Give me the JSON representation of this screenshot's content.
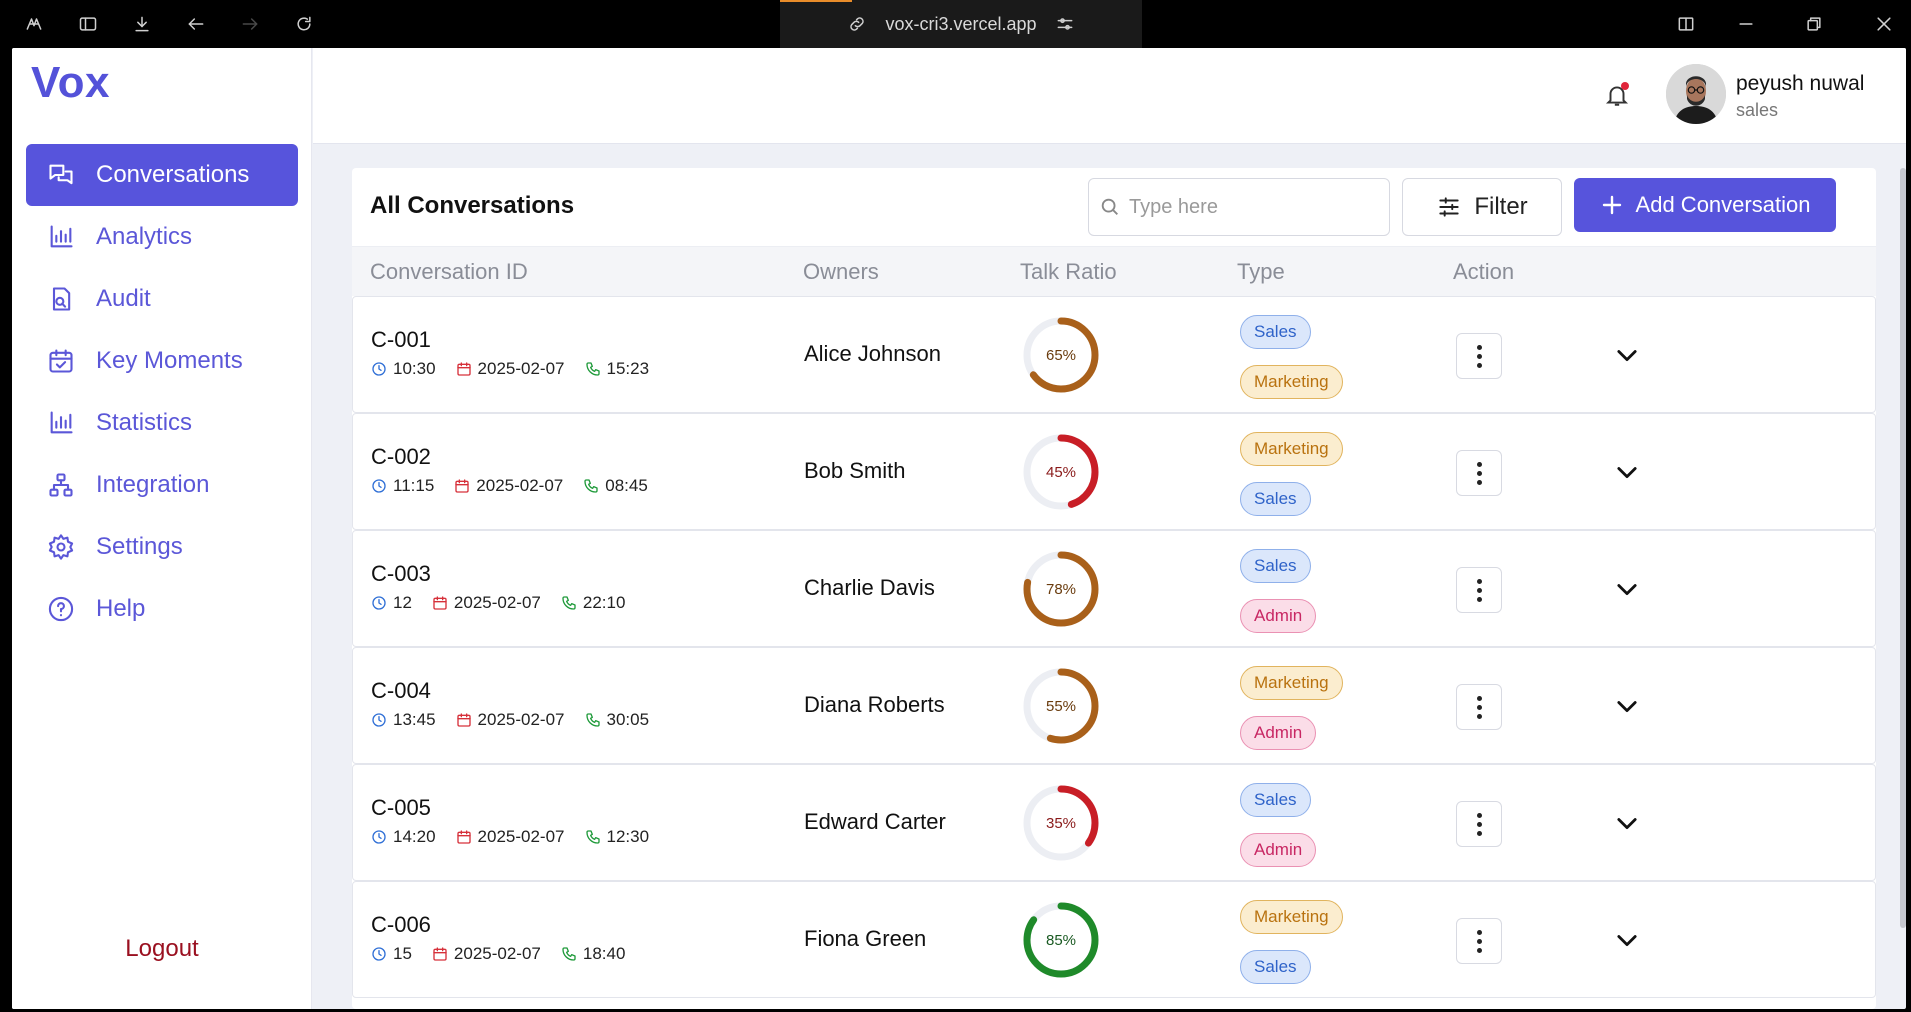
{
  "browser": {
    "url": "vox-cri3.vercel.app"
  },
  "sidebar": {
    "logo": "Vox",
    "items": [
      {
        "label": "Conversations",
        "icon": "chat-icon",
        "active": true
      },
      {
        "label": "Analytics",
        "icon": "bar-chart-icon"
      },
      {
        "label": "Audit",
        "icon": "audit-icon"
      },
      {
        "label": "Key Moments",
        "icon": "calendar-check-icon"
      },
      {
        "label": "Statistics",
        "icon": "bar-chart-icon"
      },
      {
        "label": "Integration",
        "icon": "network-icon"
      },
      {
        "label": "Settings",
        "icon": "gear-icon"
      },
      {
        "label": "Help",
        "icon": "help-icon"
      }
    ],
    "logout": "Logout"
  },
  "header": {
    "user_name": "peyush nuwal",
    "user_role": "sales"
  },
  "main": {
    "title": "All Conversations",
    "search_placeholder": "Type here",
    "filter_label": "Filter",
    "add_label": "Add Conversation",
    "columns": [
      "Conversation ID",
      "Owners",
      "Talk Ratio",
      "Type",
      "Action"
    ],
    "rows": [
      {
        "id": "C-001",
        "time": "10:30",
        "date": "2025-02-07",
        "duration": "15:23",
        "owner": "Alice Johnson",
        "ratio": 65,
        "ratio_label": "65%",
        "tags": [
          "Sales",
          "Marketing"
        ]
      },
      {
        "id": "C-002",
        "time": "11:15",
        "date": "2025-02-07",
        "duration": "08:45",
        "owner": "Bob Smith",
        "ratio": 45,
        "ratio_label": "45%",
        "tags": [
          "Marketing",
          "Sales"
        ]
      },
      {
        "id": "C-003",
        "time": "12",
        "date": "2025-02-07",
        "duration": "22:10",
        "owner": "Charlie Davis",
        "ratio": 78,
        "ratio_label": "78%",
        "tags": [
          "Sales",
          "Admin"
        ]
      },
      {
        "id": "C-004",
        "time": "13:45",
        "date": "2025-02-07",
        "duration": "30:05",
        "owner": "Diana Roberts",
        "ratio": 55,
        "ratio_label": "55%",
        "tags": [
          "Marketing",
          "Admin"
        ]
      },
      {
        "id": "C-005",
        "time": "14:20",
        "date": "2025-02-07",
        "duration": "12:30",
        "owner": "Edward Carter",
        "ratio": 35,
        "ratio_label": "35%",
        "tags": [
          "Sales",
          "Admin"
        ]
      },
      {
        "id": "C-006",
        "time": "15",
        "date": "2025-02-07",
        "duration": "18:40",
        "owner": "Fiona Green",
        "ratio": 85,
        "ratio_label": "85%",
        "tags": [
          "Marketing",
          "Sales"
        ]
      }
    ]
  },
  "colors": {
    "accent": "#5754dc",
    "ratio_high": "#1f8a2a",
    "ratio_mid": "#a9601a",
    "ratio_low": "#c81e26",
    "ring_track": "#eceef3"
  }
}
